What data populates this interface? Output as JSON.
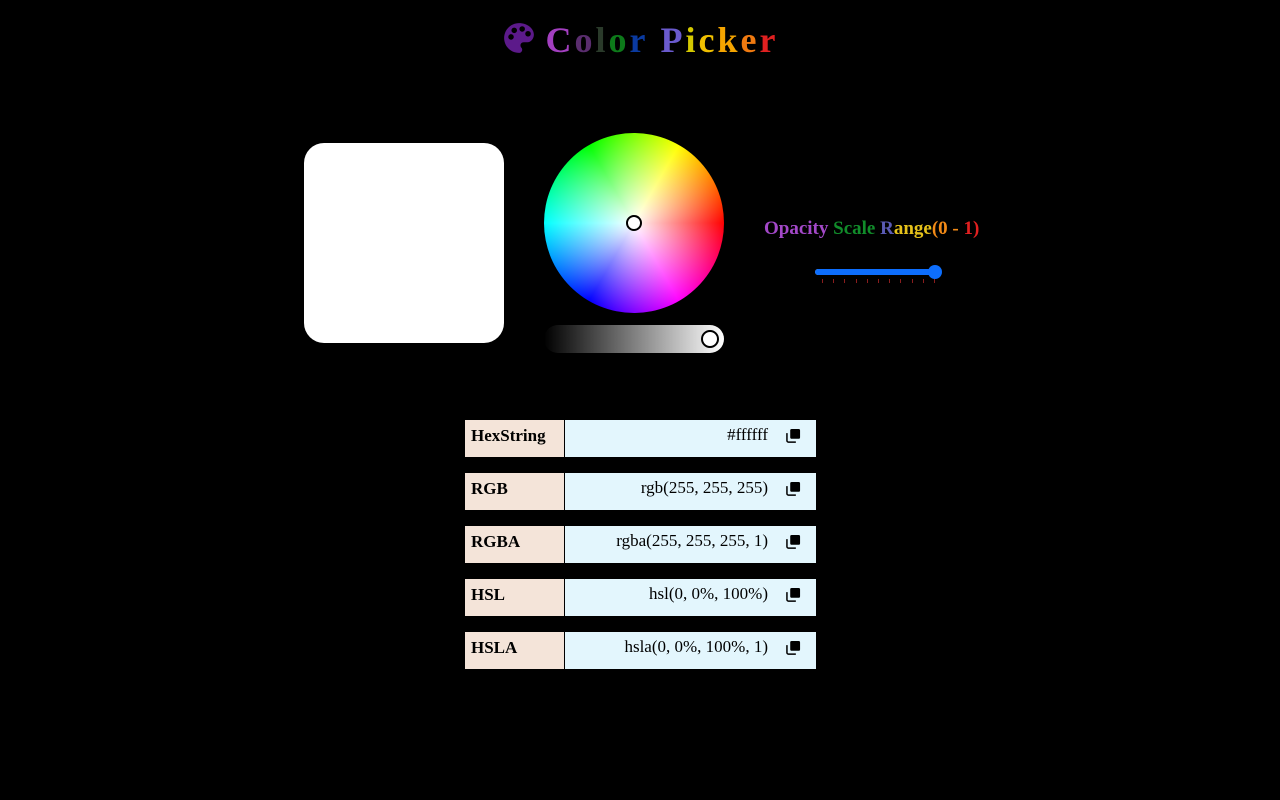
{
  "app": {
    "title_chars": [
      {
        "c": "C",
        "color": "#a33fc0"
      },
      {
        "c": "o",
        "color": "#5a2d6e"
      },
      {
        "c": "l",
        "color": "#2a3a2a"
      },
      {
        "c": "o",
        "color": "#0d7a1a"
      },
      {
        "c": "r",
        "color": "#0a3aa0"
      },
      {
        "c": " ",
        "color": "#000000"
      },
      {
        "c": "P",
        "color": "#6a5acd"
      },
      {
        "c": "i",
        "color": "#d4c900"
      },
      {
        "c": "c",
        "color": "#f0c000"
      },
      {
        "c": "k",
        "color": "#f5a500"
      },
      {
        "c": "e",
        "color": "#f07a10"
      },
      {
        "c": "r",
        "color": "#e02020"
      }
    ],
    "icon": "palette-icon",
    "icon_color": "#5c1a8a"
  },
  "color": {
    "preview_hex": "#ffffff",
    "hue": 0,
    "saturation": 0,
    "lightness": 1.0
  },
  "opacity": {
    "label_parts": [
      {
        "text": "Opacity ",
        "color": "#a348c8"
      },
      {
        "text": "Scale ",
        "color": "#118c2a"
      },
      {
        "text": "R",
        "color": "#5b5bb5"
      },
      {
        "text": "ange",
        "color": "#e6c21a"
      },
      {
        "text": "(0 - ",
        "color": "#f28a17"
      },
      {
        "text": "1)",
        "color": "#e02020"
      }
    ],
    "value": 1,
    "min": 0,
    "max": 1,
    "tick_count": 11,
    "accent": "#0d6efd"
  },
  "formats": [
    {
      "key": "HexString",
      "value": "#ffffff",
      "icon": "copy-icon"
    },
    {
      "key": "RGB",
      "value": "rgb(255, 255, 255)",
      "icon": "copy-icon"
    },
    {
      "key": "RGBA",
      "value": "rgba(255, 255, 255, 1)",
      "icon": "copy-icon"
    },
    {
      "key": "HSL",
      "value": "hsl(0, 0%, 100%)",
      "icon": "copy-icon"
    },
    {
      "key": "HSLA",
      "value": "hsla(0, 0%, 100%, 1)",
      "icon": "copy-icon"
    }
  ]
}
